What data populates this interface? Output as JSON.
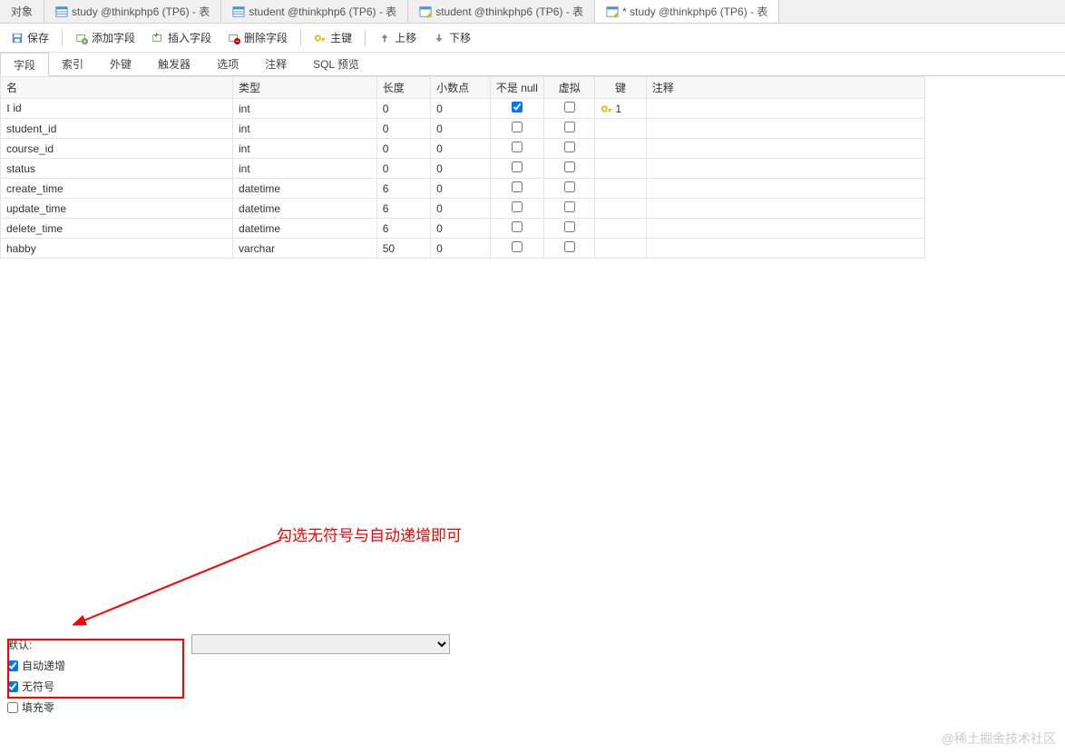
{
  "tabs": [
    {
      "label": "对象",
      "icon": "none",
      "active": false
    },
    {
      "label": "study @thinkphp6 (TP6) - 表",
      "icon": "table-blue",
      "active": false
    },
    {
      "label": "student @thinkphp6 (TP6) - 表",
      "icon": "table-blue",
      "active": false
    },
    {
      "label": "student @thinkphp6 (TP6) - 表",
      "icon": "table-design",
      "active": false
    },
    {
      "label": "* study @thinkphp6 (TP6) - 表",
      "icon": "table-design",
      "active": true
    }
  ],
  "toolbar": {
    "save": "保存",
    "add_field": "添加字段",
    "insert_field": "插入字段",
    "delete_field": "删除字段",
    "primary_key": "主键",
    "move_up": "上移",
    "move_down": "下移"
  },
  "subtabs": [
    "字段",
    "索引",
    "外键",
    "触发器",
    "选项",
    "注释",
    "SQL 预览"
  ],
  "subtab_active": 0,
  "columns": {
    "name": "名",
    "type": "类型",
    "length": "长度",
    "decimals": "小数点",
    "not_null": "不是 null",
    "virtual": "虚拟",
    "key": "键",
    "comment": "注释"
  },
  "rows": [
    {
      "name": "id",
      "type": "int",
      "length": "0",
      "decimals": "0",
      "not_null": true,
      "virtual": false,
      "key": "1",
      "comment": "",
      "cursor": true
    },
    {
      "name": "student_id",
      "type": "int",
      "length": "0",
      "decimals": "0",
      "not_null": false,
      "virtual": false,
      "key": "",
      "comment": ""
    },
    {
      "name": "course_id",
      "type": "int",
      "length": "0",
      "decimals": "0",
      "not_null": false,
      "virtual": false,
      "key": "",
      "comment": ""
    },
    {
      "name": "status",
      "type": "int",
      "length": "0",
      "decimals": "0",
      "not_null": false,
      "virtual": false,
      "key": "",
      "comment": ""
    },
    {
      "name": "create_time",
      "type": "datetime",
      "length": "6",
      "decimals": "0",
      "not_null": false,
      "virtual": false,
      "key": "",
      "comment": ""
    },
    {
      "name": "update_time",
      "type": "datetime",
      "length": "6",
      "decimals": "0",
      "not_null": false,
      "virtual": false,
      "key": "",
      "comment": ""
    },
    {
      "name": "delete_time",
      "type": "datetime",
      "length": "6",
      "decimals": "0",
      "not_null": false,
      "virtual": false,
      "key": "",
      "comment": ""
    },
    {
      "name": "habby",
      "type": "varchar",
      "length": "50",
      "decimals": "0",
      "not_null": false,
      "virtual": false,
      "key": "",
      "comment": ""
    }
  ],
  "bottom": {
    "default_label": "默认:",
    "auto_increment": "自动递增",
    "auto_increment_checked": true,
    "unsigned": "无符号",
    "unsigned_checked": true,
    "zerofill": "填充零",
    "zerofill_checked": false
  },
  "annotation": "勾选无符号与自动递增即可",
  "watermark": "@稀土掘金技术社区"
}
